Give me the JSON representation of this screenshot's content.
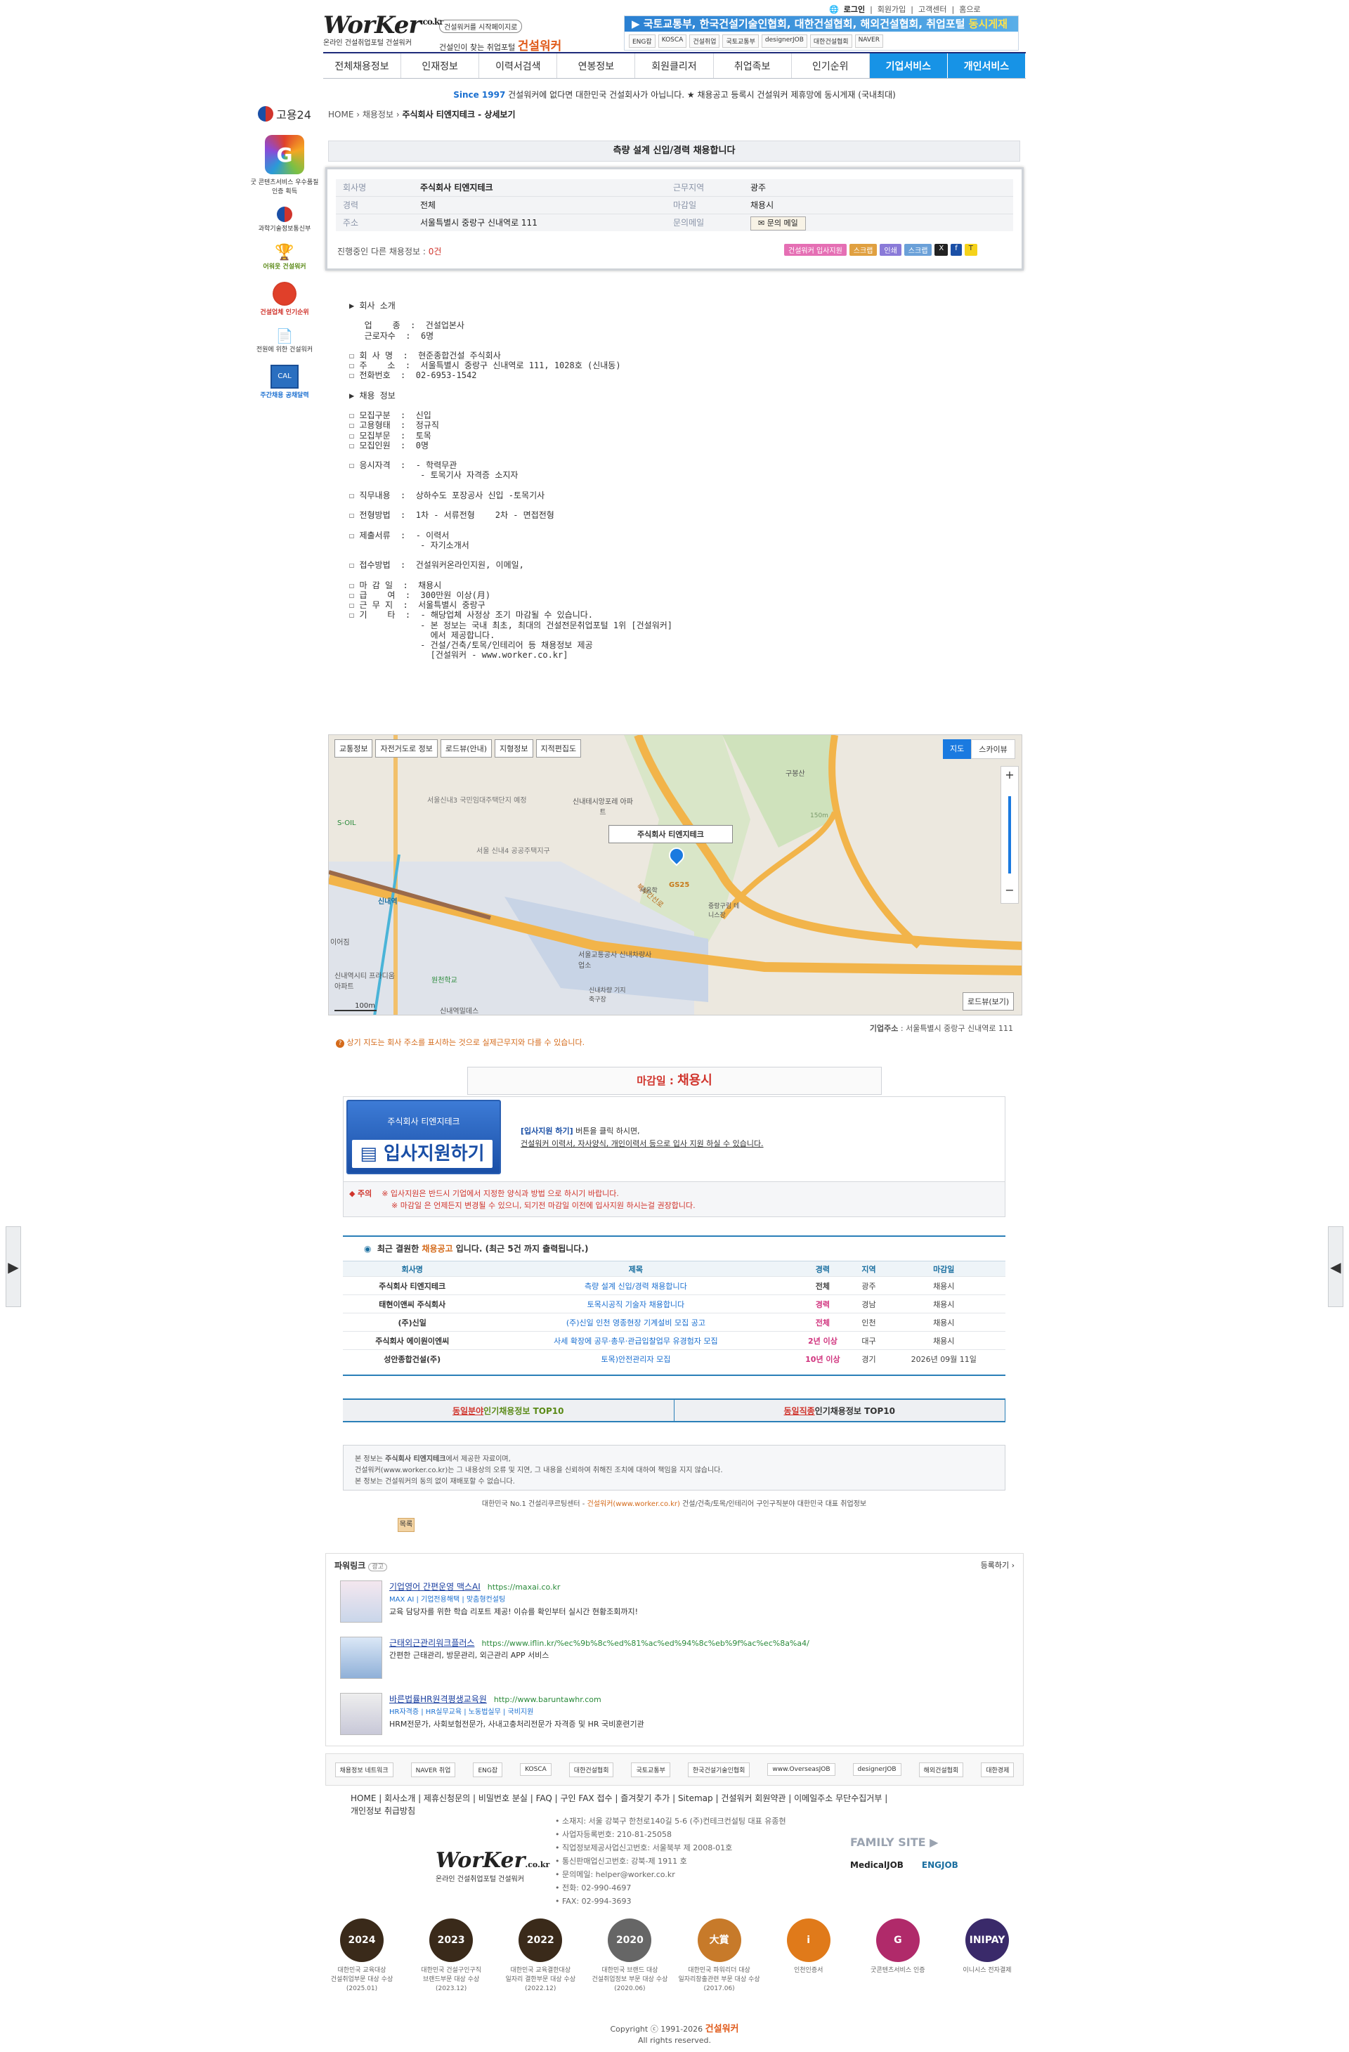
{
  "top_links": [
    "로그인",
    "회원가입",
    "고객센터",
    "홈으로"
  ],
  "logo": {
    "brand": "WorKer",
    "domain": ".co.kr",
    "sub": "온라인 건설취업포털 건설워커"
  },
  "slogan": {
    "pill": "건설워커를 시작페이지로",
    "line": "건설인이 찾는 취업포털",
    "brand": "건설워커"
  },
  "banner": {
    "text": "▶ 국토교통부, 한국건설기술인협회, 대한건설협회, 해외건설협회, 취업포털 ",
    "highlight": "동시게재",
    "logos": [
      "ENG잡",
      "KOSCA",
      "건설취업",
      "국토교통부",
      "designerJOB",
      "대한건설협회",
      "NAVER"
    ]
  },
  "nav": [
    "전체채용정보",
    "인재정보",
    "이력서검색",
    "연봉정보",
    "회원클리저",
    "취업족보",
    "인기순위",
    "기업서비스",
    "개인서비스"
  ],
  "notice": {
    "since": "Since 1997",
    "text": " 건설워커에 없다면 대한민국 건설회사가 아닙니다. ★ 채용공고 등록시 건설워커 제휴망에 동시게재 (국내최대)"
  },
  "breadcrumb": {
    "home": "HOME",
    "cat": "채용정보",
    "page": "주식회사 티엔지테크 - 상세보기"
  },
  "leftsb": {
    "gov": "고용24",
    "g_label": "굿 콘텐츠서비스 우수품질인증 획득",
    "ministry": "과학기술정보통신부",
    "i1": "어워웃 건설워커",
    "i2": "건설업체 인기순위",
    "i3": "전원에 위한 건설워커",
    "i4": "주간채용 공채달력"
  },
  "job_title": "측량 설계 신입/경력 채용합니다",
  "info": {
    "company_label": "회사명",
    "company": "주식회사 티엔지테크",
    "region_label": "근무지역",
    "region": "광주",
    "exp_label": "경력",
    "exp": "전체",
    "deadline_label": "마감일",
    "deadline": "채용시",
    "addr_label": "주소",
    "addr": "서울특별시 중랑구 신내역로 111",
    "inq_label": "문의메일",
    "inq_btn": "문의 메일",
    "ongoing": "진행중인 다른 채용정보 : ",
    "ongoing_count": "0건",
    "buttons": [
      "건설워커 입사지원",
      "스크랩",
      "인쇄",
      "스크랩"
    ]
  },
  "description": "▶ 회사 소개\n\n   업    종  :  건설업본사\n   근로자수  :  6명\n\n☐ 회 사 명  :  현준종합건설 주식회사\n☐ 주    소  :  서울특별시 중랑구 신내역로 111, 1028호 (신내동)\n☐ 전화번호  :  02-6953-1542\n\n▶ 채용 정보\n\n☐ 모집구분  :  신입\n☐ 고용형태  :  정규직\n☐ 모집부문  :  토목\n☐ 모집인원  :  0명\n\n☐ 응시자격  :  - 학력무관\n              - 토목기사 자격증 소지자\n\n☐ 직무내용  :  상하수도 포장공사 신입 -토목기사\n\n☐ 전형방법  :  1차 - 서류전형    2차 - 면접전형\n\n☐ 제출서류  :  - 이력서\n              - 자기소개서\n\n☐ 접수방법  :  건설워커온라인지원, 이메일,\n\n☐ 마 감 일  :  채용시\n☐ 급    여  :  300만원 이상(月)\n☐ 근 무 지  :  서울특별시 중랑구\n☐ 기    타  :  - 해당업체 사정상 조기 마감될 수 있습니다.\n              - 본 정보는 국내 최초, 최대의 건설전문취업포털 1위 [건설워커]\n                에서 제공합니다.\n              - 건설/건축/토목/인테리어 등 채용정보 제공\n                [건설워커 - www.worker.co.kr]",
  "map": {
    "buttons": [
      "교통정보",
      "자전거도로 정보",
      "로드뷰(안내)",
      "지형정보",
      "지적편집도"
    ],
    "map_type": "지도",
    "sky_type": "스카이뷰",
    "marker_label": "주식회사 티엔지테크",
    "roadview": "로드뷰(보기)",
    "scale": "100m",
    "labels": [
      "신내테시앙포레 아파트",
      "서울 신내4 공공주택지구",
      "신내역",
      "S-OIL",
      "구봉산",
      "중랑구립 테니스장",
      "서울교통공사 신내차량사업소",
      "신내역시티 프라디움아파트",
      "원천학교",
      "신내역밀데스",
      "서울신내3 국민임대주택단지 예정",
      "북부간선로",
      "GS25",
      "150m",
      "세움학",
      "신내차량 기지축구장",
      "이어짐"
    ]
  },
  "map_caption": {
    "label": "기업주소",
    "value": " : 서울특별시 중랑구 신내역로 111"
  },
  "map_note": "상기 지도는 회사 주소를 표시하는 것으로 실제근무지와 다를 수 있습니다.",
  "apply": {
    "deadline_label": "마감일 : ",
    "deadline": "채용시",
    "company": "주식회사 티엔지테크",
    "button": "입사지원하기",
    "text1": "[입사지원 하기]",
    "text1b": " 버튼을 클릭 하시면,",
    "text2": "건설워커 이력서, 자사양식, 개인이력서 등으로 입사 지원 하실 수 있습니다.",
    "caution_label": "주의",
    "caution1": "※ 입사지원은 반드시 기업에서 지정한 양식과 방법 으로 하시기 바랍니다.",
    "caution2": "※ 마감일 은 언제든지 변경될 수 있으니, 되기전 마감일 이전에 입사지원 하시는걸 권장합니다."
  },
  "recent": {
    "title_pre": "최근 결원한 ",
    "title_hl": "채용공고",
    "title_post": " 입니다.   (최근 5건 까지 출력됩니다.)",
    "headers": [
      "회사명",
      "제목",
      "경력",
      "지역",
      "마감일"
    ],
    "rows": [
      [
        "주식회사 티엔지테크",
        "측량 설계 신입/경력 채용합니다",
        "전체",
        "광주",
        "채용시"
      ],
      [
        "태현이앤씨 주식회사",
        "토목시공직 기술자 채용합니다",
        "경력",
        "경남",
        "채용시"
      ],
      [
        "(주)신일",
        "(주)신일 인천 영종현장 기계설비 모집 공고",
        "전체",
        "인천",
        "채용시"
      ],
      [
        "주식회사 에이원이엔씨",
        "사세 확장에 공무·총무·관급입찰업무 유경험자 모집",
        "2년 이상",
        "대구",
        "채용시"
      ],
      [
        "성안종합건설(주)",
        "토목)안전관리자 모집",
        "10년 이상",
        "경기",
        "2026년 09월 11일"
      ]
    ]
  },
  "top10": [
    {
      "u": "동일분야",
      "t": " 인기채용정보 TOP10"
    },
    {
      "u": "동일직종",
      "t": " 인기채용정보 TOP10"
    }
  ],
  "disclaimer": {
    "l1a": "본 정보는 ",
    "l1b": "주식회사 티엔지테크",
    "l1c": "에서 제공한 자료이며,",
    "l2": "건설워커(www.worker.co.kr)는 그 내용상의 오류 및 지연, 그 내용을 신뢰하여 취해진 조치에 대하여 책임을 지지 않습니다.",
    "l3": "본 정보는 건설워커의 동의 없이 재배포할 수 없습니다."
  },
  "tagline": {
    "a": "대한민국 No.1 건설리쿠르팅센터 - ",
    "b": "건설워커(www.worker.co.kr)",
    "c": " 건설/건축/토목/인테리어 구인구직분야 대한민국 대표 취업정보"
  },
  "list_btn": "목록",
  "powerlink": {
    "title": "파워링크",
    "ad": "광고",
    "register": "등록하기 ›",
    "items": [
      {
        "title": "기업영어 간편운영 맥스AI",
        "url": "https://maxai.co.kr",
        "sub": "MAX AI | 기업전용해택 | 맞춤형컨설팅",
        "desc": "교육 담당자를 위한 학습 리포트 제공! 이슈를 확인부터 실시간 현황조회까지!"
      },
      {
        "title": "근태외근관리워크플러스",
        "url": "https://www.iflin.kr/%ec%9b%8c%ed%81%ac%ed%94%8c%eb%9f%ac%ec%8a%a4/",
        "sub": "",
        "desc": "간편한 근태관리, 방문관리, 외근관리 APP 서비스"
      },
      {
        "title": "바른법률HR원격평생교육원",
        "url": "http://www.baruntawhr.com",
        "sub": "HR자격증 | HR실무교육 | 노동법실무 | 국비지원",
        "desc": "HRM전문가, 사회보험전문가, 사내고충처리전문가 자격증 및 HR 국비훈련기관"
      }
    ]
  },
  "partners": [
    "채용정보 네트워크",
    "NAVER 취업",
    "ENG잡",
    "KOSCA",
    "대한건설협회",
    "국토교통부",
    "한국건설기술인협회",
    "www.OverseasJOB",
    "designerJOB",
    "해외건설협회",
    "대한경제"
  ],
  "foot_nav": [
    "HOME",
    "회사소개",
    "제휴신청문의",
    "비밀번호 분실",
    "FAQ",
    "구인 FAX 접수",
    "즐겨찾기 추가",
    "Sitemap",
    "건설워커 회원약관",
    "이메일주소 무단수집거부",
    "개인정보 취급방침"
  ],
  "foot_info": [
    "소재지: 서울 강북구 한천로140길 5-6 (주)컨테크컨설팅 대표 유종현",
    "사업자등록번호: 210-81-25058",
    "직업정보제공사업신고번호: 서울북부 제 2008-01호",
    "통신판매업신고번호: 강북-제 1911 호",
    "문의메일: helper@worker.co.kr",
    "전화: 02-990-4697",
    "FAX: 02-994-3693"
  ],
  "family": {
    "title": "FAMILY SITE ▶",
    "sites": [
      "MedicalJOB",
      "ENGJOB"
    ]
  },
  "awards": [
    {
      "badge": "2024",
      "l1": "대한민국 교육대상",
      "l2": "건설취업부문 대상 수상",
      "l3": "(2025.01)",
      "color": "#3a2a1a"
    },
    {
      "badge": "2023",
      "l1": "대한민국 건설구인구직",
      "l2": "브랜드부문 대상 수상",
      "l3": "(2023.12)",
      "color": "#3a2a1a"
    },
    {
      "badge": "2022",
      "l1": "대한민국 교육결한대상",
      "l2": "일자리 결한부문 대상 수상",
      "l3": "(2022.12)",
      "color": "#3a2a1a"
    },
    {
      "badge": "2020",
      "l1": "대한민국 브랜드 대상",
      "l2": "건설취업정보 부문 대상 수상",
      "l3": "(2020.06)",
      "color": "#666"
    },
    {
      "badge": "大賞",
      "l1": "대한민국 파워리더 대상",
      "l2": "일자리창출관련 부문 대상 수상",
      "l3": "(2017.06)",
      "color": "#c77a2a"
    },
    {
      "badge": "i",
      "l1": "인천인증서",
      "l2": "",
      "l3": "",
      "color": "#e07a1a"
    },
    {
      "badge": "G",
      "l1": "굿콘텐츠서비스 인증",
      "l2": "",
      "l3": "",
      "color": "#b02a6a"
    },
    {
      "badge": "INIPAY",
      "l1": "이니시스 전자결제",
      "l2": "",
      "l3": "",
      "color": "#3a2a6a"
    }
  ],
  "copyright": {
    "pre": "Copyright ⓒ 1991-2026 ",
    "brand": "건설워커",
    "post": "All rights reserved."
  }
}
